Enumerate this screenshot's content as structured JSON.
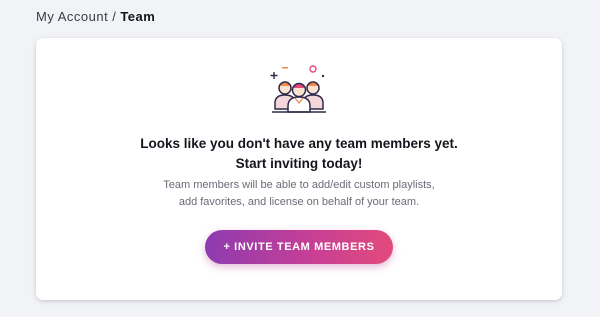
{
  "breadcrumb": {
    "parent": "My Account",
    "separator": "/",
    "current": "Team"
  },
  "empty_state": {
    "icon": "team-members-icon",
    "headline_line1": "Looks like you don't have any team members yet.",
    "headline_line2": "Start inviting today!",
    "description_line1": "Team members will be able to add/edit custom playlists,",
    "description_line2": "add favorites, and license on behalf of your team."
  },
  "actions": {
    "invite_label": "+ INVITE TEAM MEMBERS"
  },
  "colors": {
    "page_background": "#f1f3f6",
    "card_background": "#ffffff",
    "button_gradient_start": "#8d3bb0",
    "button_gradient_end": "#e24a7c",
    "icon_outline": "#2d2a4a",
    "icon_accent_orange": "#f08a4b",
    "icon_accent_pink": "#e24a7c"
  }
}
